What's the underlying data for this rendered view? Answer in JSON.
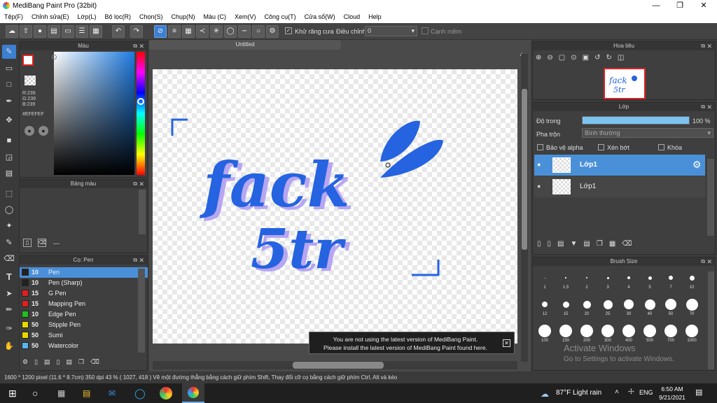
{
  "app": {
    "title": "MediBang Paint Pro (32bit)"
  },
  "menu": [
    "Tệp(F)",
    "Chỉnh sửa(E)",
    "Lớp(L)",
    "Bộ lọc(R)",
    "Chọn(S)",
    "Chụp(N)",
    "Màu (C)",
    "Xem(V)",
    "Công cụ(T)",
    "Cửa sổ(W)",
    "Cloud",
    "Help"
  ],
  "toolbar": {
    "antialias_label": "Khử răng cưa",
    "adjust_label": "Điều chỉnh",
    "adjust_value": "0",
    "edge_label": "Cạnh mềm"
  },
  "color_panel": {
    "title": "Màu",
    "r": "R:239",
    "g": "G:239",
    "b": "B:239",
    "hex": "#EFEFEF"
  },
  "palette_panel": {
    "title": "Bảng màu",
    "value": "---"
  },
  "brush_panel": {
    "title": "Cọ: Pen",
    "items": [
      {
        "size": "10",
        "name": "Pen",
        "color": "#222222"
      },
      {
        "size": "10",
        "name": "Pen (Sharp)",
        "color": "#222222"
      },
      {
        "size": "15",
        "name": "G Pen",
        "color": "#e02020"
      },
      {
        "size": "15",
        "name": "Mapping Pen",
        "color": "#e02020"
      },
      {
        "size": "10",
        "name": "Edge Pen",
        "color": "#20c020"
      },
      {
        "size": "50",
        "name": "Stipple Pen",
        "color": "#e8d800"
      },
      {
        "size": "50",
        "name": "Sumi",
        "color": "#e8d800"
      },
      {
        "size": "50",
        "name": "Watercolor",
        "color": "#5ab4f0"
      }
    ]
  },
  "canvas": {
    "tab": "Untitled",
    "drawing_text1": "fack",
    "drawing_text2": "5tr"
  },
  "notice": {
    "line1": "You are not using the latest version of MediBang Paint.",
    "line2": "Please install the latest version of MediBang Paint found here."
  },
  "navigator": {
    "title": "Hoa tiêu"
  },
  "layer_panel": {
    "title": "Lớp",
    "opacity_label": "Độ trong",
    "opacity_value": "100 %",
    "opacity_fraction": 1.0,
    "blend_label": "Pha trộn",
    "blend_value": "Bình thường",
    "protect_alpha": "Bảo vệ alpha",
    "clipping": "Xén bớt",
    "lock": "Khóa",
    "layers": [
      {
        "name": "Lớp1"
      },
      {
        "name": "Lớp1"
      }
    ]
  },
  "brush_size": {
    "title": "Brush Size",
    "sizes": [
      "1",
      "1.5",
      "2",
      "3",
      "4",
      "5",
      "7",
      "10",
      "12",
      "15",
      "20",
      "25",
      "30",
      "40",
      "50",
      "70",
      "100",
      "150",
      "200",
      "300",
      "400",
      "500",
      "700",
      "1000"
    ]
  },
  "watermark": {
    "line1": "Activate Windows",
    "line2": "Go to Settings to activate Windows."
  },
  "status": {
    "text": "1600 * 1200 pixel  (11.6 * 8.7cm)  350 dpi  43 %  ( 1027, 418 )  Vẽ một đường thẳng bằng cách giữ phím Shift, Thay đổi cỡ cọ bằng cách giữ phím Ctrl, Alt và kéo"
  },
  "taskbar": {
    "weather": "87°F  Light rain",
    "lang": "ENG",
    "time": "6:50 AM",
    "date": "9/21/2021"
  }
}
